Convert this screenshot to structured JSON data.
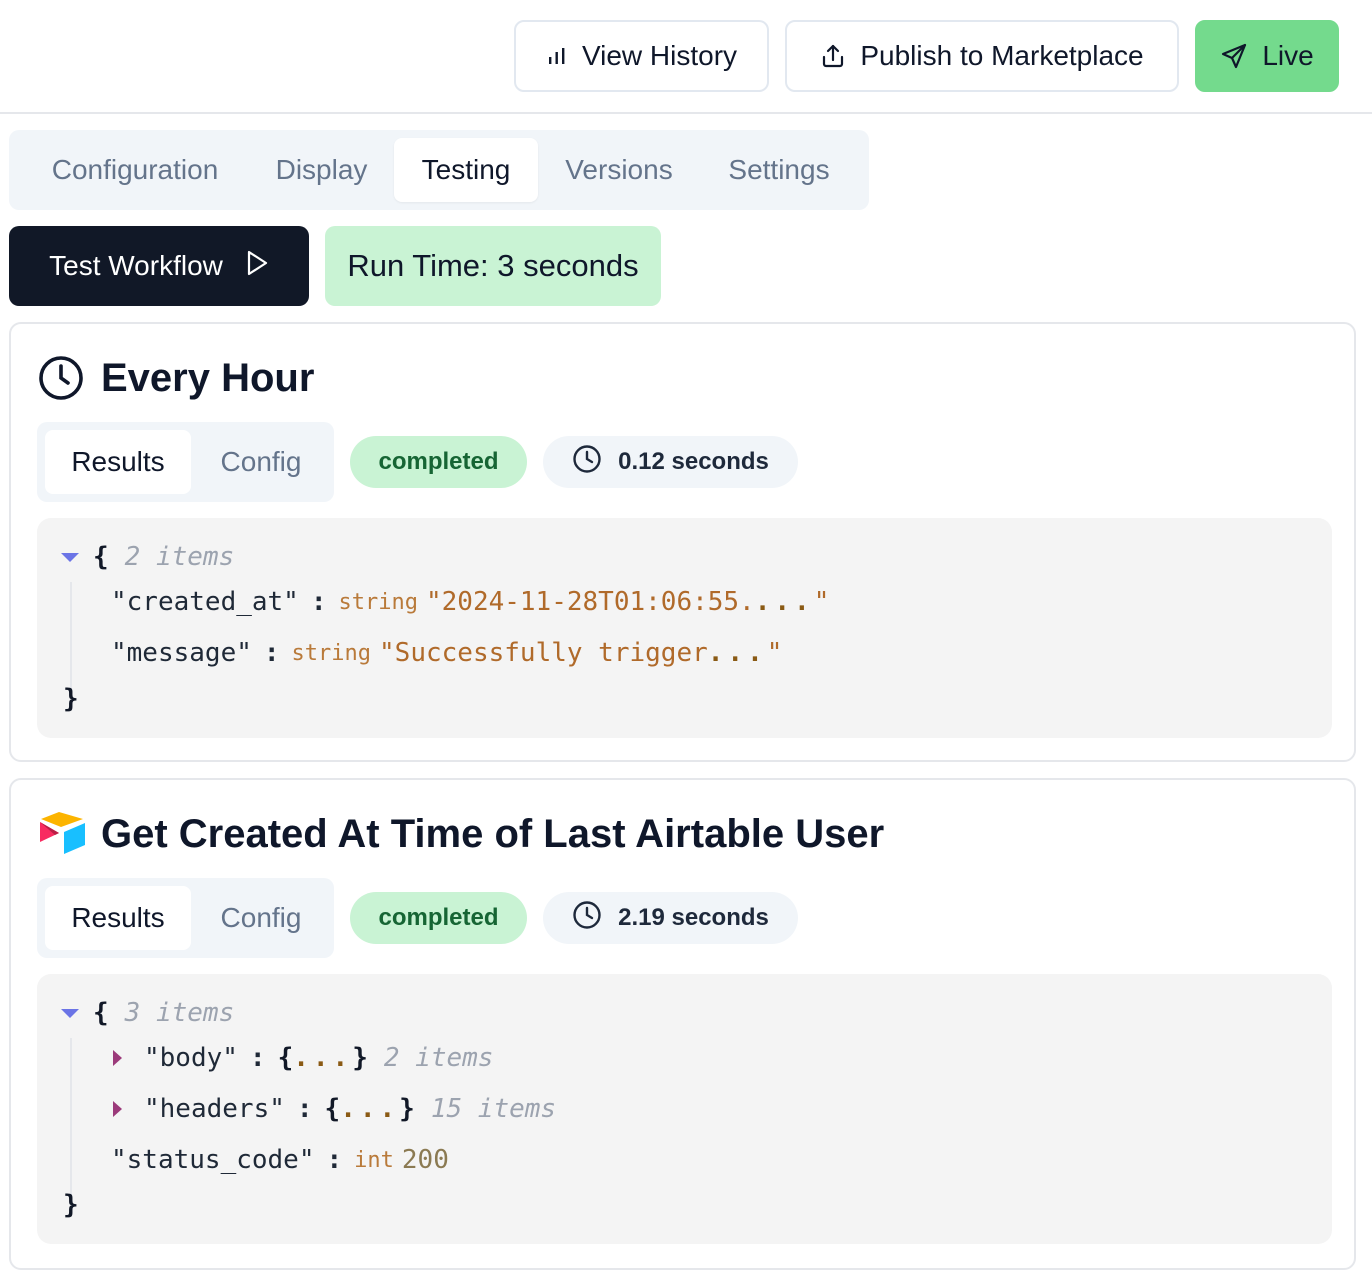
{
  "header": {
    "view_history_label": "View History",
    "publish_label": "Publish to Marketplace",
    "live_label": "Live",
    "live_color": "#74da8d"
  },
  "tabs": [
    {
      "label": "Configuration",
      "active": false
    },
    {
      "label": "Display",
      "active": false
    },
    {
      "label": "Testing",
      "active": true
    },
    {
      "label": "Versions",
      "active": false
    },
    {
      "label": "Settings",
      "active": false
    }
  ],
  "test": {
    "button_label": "Test Workflow",
    "run_time": "Run Time: 3 seconds"
  },
  "steps": [
    {
      "icon": "clock-icon",
      "title": "Every Hour",
      "results_tab": "Results",
      "config_tab": "Config",
      "status": "completed",
      "duration": "0.12 seconds",
      "json": {
        "open": "{",
        "count": "2 items",
        "close": "}",
        "entries": [
          {
            "key": "\"created_at\"",
            "type": "string",
            "value": "\"2024-11-28T01:06:55.",
            "ellipsis": "...",
            "end": "\""
          },
          {
            "key": "\"message\"",
            "type": "string",
            "value": "\"Successfully trigger",
            "ellipsis": "...",
            "end": "\""
          }
        ]
      }
    },
    {
      "icon": "airtable-logo-icon",
      "title": "Get Created At Time of Last Airtable User",
      "results_tab": "Results",
      "config_tab": "Config",
      "status": "completed",
      "duration": "2.19 seconds",
      "json": {
        "open": "{",
        "count": "3 items",
        "close": "}",
        "entries": [
          {
            "key": "\"body\"",
            "collapsed_open": "{",
            "ellipsis": "...",
            "collapsed_close": "}",
            "count": "2 items"
          },
          {
            "key": "\"headers\"",
            "collapsed_open": "{",
            "ellipsis": "...",
            "collapsed_close": "}",
            "count": "15 items"
          },
          {
            "key": "\"status_code\"",
            "type": "int",
            "value": "200"
          }
        ]
      }
    }
  ],
  "colors": {
    "primary_dark": "#111827",
    "success_bg": "#c9f3d4",
    "success_text": "#166534",
    "json_bg": "#f4f4f4"
  }
}
